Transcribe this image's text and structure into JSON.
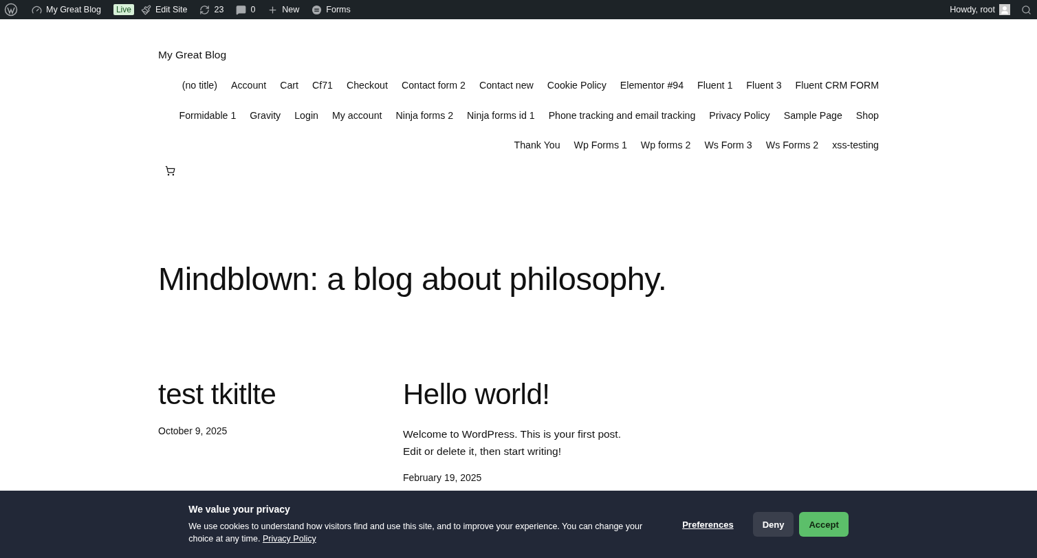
{
  "admin_bar": {
    "site_name": "My Great Blog",
    "live_badge": "Live",
    "edit_site": "Edit Site",
    "updates": "23",
    "comments": "0",
    "new": "New",
    "forms": "Forms",
    "greeting": "Howdy, root"
  },
  "site_title": "My Great Blog",
  "nav": [
    "(no title)",
    "Account",
    "Cart",
    "Cf71",
    "Checkout",
    "Contact form 2",
    "Contact new",
    "Cookie Policy",
    "Elementor #94",
    "Fluent 1",
    "Fluent 3",
    "Fluent CRM FORM",
    "Formidable 1",
    "Gravity",
    "Login",
    "My account",
    "Ninja forms 2",
    "Ninja forms id 1",
    "Phone tracking and email tracking",
    "Privacy Policy",
    "Sample Page",
    "Shop",
    "Thank You",
    "Wp Forms 1",
    "Wp forms 2",
    "Ws Form 3",
    "Ws Forms 2",
    "xss-testing"
  ],
  "headline": "Mindblown: a blog about philosophy.",
  "posts": [
    {
      "title": "test tkitlte",
      "date": "October 9, 2025"
    },
    {
      "title": "Hello world!",
      "excerpt": [
        "Welcome to WordPress. This is your first post.",
        "Edit or delete it, then start writing!"
      ],
      "date": "February 19, 2025"
    }
  ],
  "cookie_banner": {
    "title": "We value your privacy",
    "text": "We use cookies to understand how visitors find and use this site, and to improve your experience. You can change your choice at any time.",
    "link": "Privacy Policy",
    "preferences": "Preferences",
    "deny": "Deny",
    "accept": "Accept"
  }
}
